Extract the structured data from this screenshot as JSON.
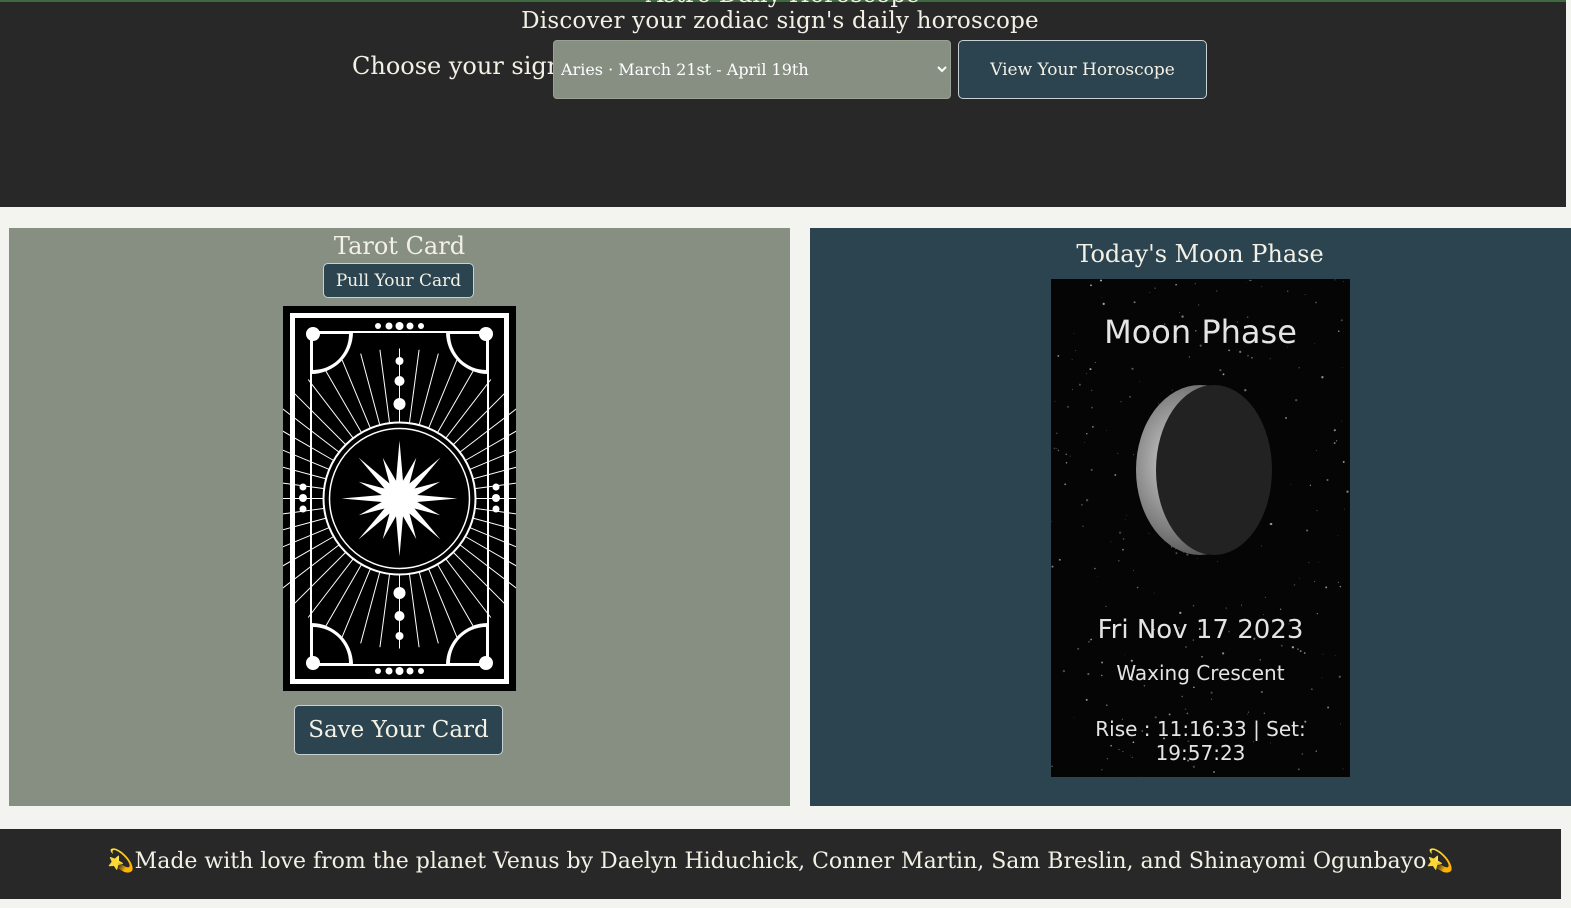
{
  "header": {
    "title_partial": "Astro Daily Horoscope",
    "subtitle": "Discover your zodiac sign's daily horoscope",
    "choose_label": "Choose your sign:",
    "sign_select_value": "Aries · March 21st - April 19th",
    "view_button": "View Your Horoscope"
  },
  "tarot": {
    "title": "Tarot Card",
    "pull_button": "Pull Your Card",
    "card_image": "tarot-card-back",
    "save_button": "Save Your Card"
  },
  "moon": {
    "title": "Today's Moon Phase",
    "widget": {
      "heading": "Moon Phase",
      "date": "Fri Nov 17 2023",
      "phase": "Waxing Crescent",
      "rise_set": "Rise : 11:16:33 | Set: 19:57:23"
    }
  },
  "footer": {
    "text": "💫Made with love from the planet Venus by Daelyn Hiduchick, Conner Martin, Sam Breslin, and Shinayomi Ogunbayo💫"
  },
  "colors": {
    "dark": "#282828",
    "sage": "#868f81",
    "slate": "#2b4450",
    "cream": "#f3f4ef"
  }
}
